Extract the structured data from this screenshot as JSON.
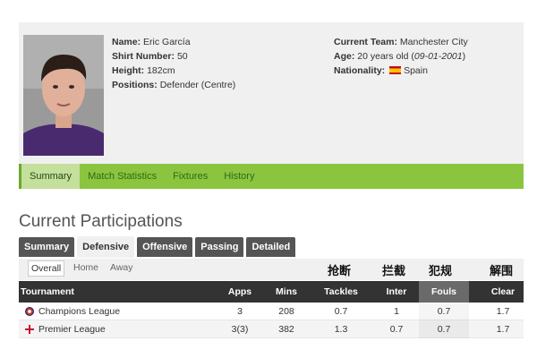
{
  "player": {
    "name_label": "Name:",
    "name": "Eric García",
    "shirt_label": "Shirt Number:",
    "shirt": "50",
    "height_label": "Height:",
    "height": "182cm",
    "positions_label": "Positions:",
    "positions": "Defender (Centre)",
    "team_label": "Current Team:",
    "team": "Manchester City",
    "age_label": "Age:",
    "age": "20 years old (",
    "dob": "09-01-2001",
    "age_close": ")",
    "nationality_label": "Nationality:",
    "nationality": "Spain",
    "flag_icon": "spain-flag-icon"
  },
  "nav": {
    "items": [
      "Summary",
      "Match Statistics",
      "Fixtures",
      "History"
    ],
    "active": "Summary",
    "colors": {
      "bar": "#8bc53f",
      "active": "#c5df9c"
    }
  },
  "section_title": "Current Participations",
  "tabs": {
    "items": [
      "Summary",
      "Defensive",
      "Offensive",
      "Passing",
      "Detailed"
    ],
    "active": "Defensive"
  },
  "filters": {
    "items": [
      "Overall",
      "Home",
      "Away"
    ],
    "active": "Overall"
  },
  "annotations": [
    "抢断",
    "拦截",
    "犯规",
    "解围"
  ],
  "table": {
    "headers": [
      "Tournament",
      "Apps",
      "Mins",
      "Tackles",
      "Inter",
      "Fouls",
      "Clear"
    ],
    "sorted_column": "Fouls",
    "rows": [
      {
        "tournament": "Champions League",
        "icon": "champions-league-icon",
        "apps": "3",
        "mins": "208",
        "tackles": "0.7",
        "inter": "1",
        "fouls": "0.7",
        "clear": "1.7"
      },
      {
        "tournament": "Premier League",
        "icon": "premier-league-icon",
        "apps": "3(3)",
        "mins": "382",
        "tackles": "1.3",
        "inter": "0.7",
        "fouls": "0.7",
        "clear": "1.7"
      }
    ]
  }
}
